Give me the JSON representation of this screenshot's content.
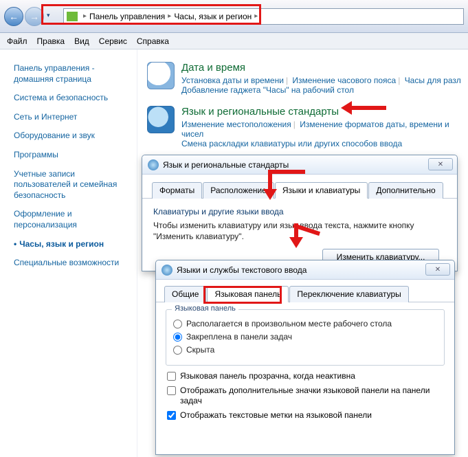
{
  "toolbar": {
    "back_icon": "←",
    "fwd_icon": "→",
    "breadcrumb": {
      "icon_title": "Панель управления",
      "item1": "Панель управления",
      "item2": "Часы, язык и регион",
      "sep": "▸"
    }
  },
  "menubar": {
    "file": "Файл",
    "edit": "Правка",
    "view": "Вид",
    "service": "Сервис",
    "help": "Справка"
  },
  "sidebar": {
    "home": "Панель управления - домашняя страница",
    "items": [
      "Система и безопасность",
      "Сеть и Интернет",
      "Оборудование и звук",
      "Программы",
      "Учетные записи пользователей и семейная безопасность",
      "Оформление и персонализация",
      "Часы, язык и регион",
      "Специальные возможности"
    ],
    "active_index": 6
  },
  "main": {
    "datetime": {
      "title": "Дата и время",
      "l1": "Установка даты и времени",
      "l2": "Изменение часового пояса",
      "l3": "Часы для разл",
      "l4": "Добавление гаджета \"Часы\" на рабочий стол"
    },
    "region": {
      "title": "Язык и региональные стандарты",
      "l1": "Изменение местоположения",
      "l2": "Изменение форматов даты, времени и чисел",
      "l3": "Смена раскладки клавиатуры или других способов ввода"
    }
  },
  "dialog1": {
    "title": "Язык и региональные стандарты",
    "tabs": [
      "Форматы",
      "Расположение",
      "Языки и клавиатуры",
      "Дополнительно"
    ],
    "active_tab": 2,
    "group_heading": "Клавиатуры и другие языки ввода",
    "para": "Чтобы изменить клавиатуру или язык ввода текста, нажмите кнопку \"Изменить клавиатуру\".",
    "btn": "Изменить клавиатуру..."
  },
  "dialog2": {
    "title": "Языки и службы текстового ввода",
    "tabs": [
      "Общие",
      "Языковая панель",
      "Переключение клавиатуры"
    ],
    "active_tab": 1,
    "group_legend": "Языковая панель",
    "radios": [
      "Располагается в произвольном месте рабочего стола",
      "Закреплена в панели задач",
      "Скрыта"
    ],
    "radio_selected": 1,
    "checks": [
      {
        "label": "Языковая панель прозрачна, когда неактивна",
        "checked": false
      },
      {
        "label": "Отображать дополнительные значки языковой панели на панели задач",
        "checked": false
      },
      {
        "label": "Отображать текстовые метки на языковой панели",
        "checked": true
      }
    ]
  }
}
